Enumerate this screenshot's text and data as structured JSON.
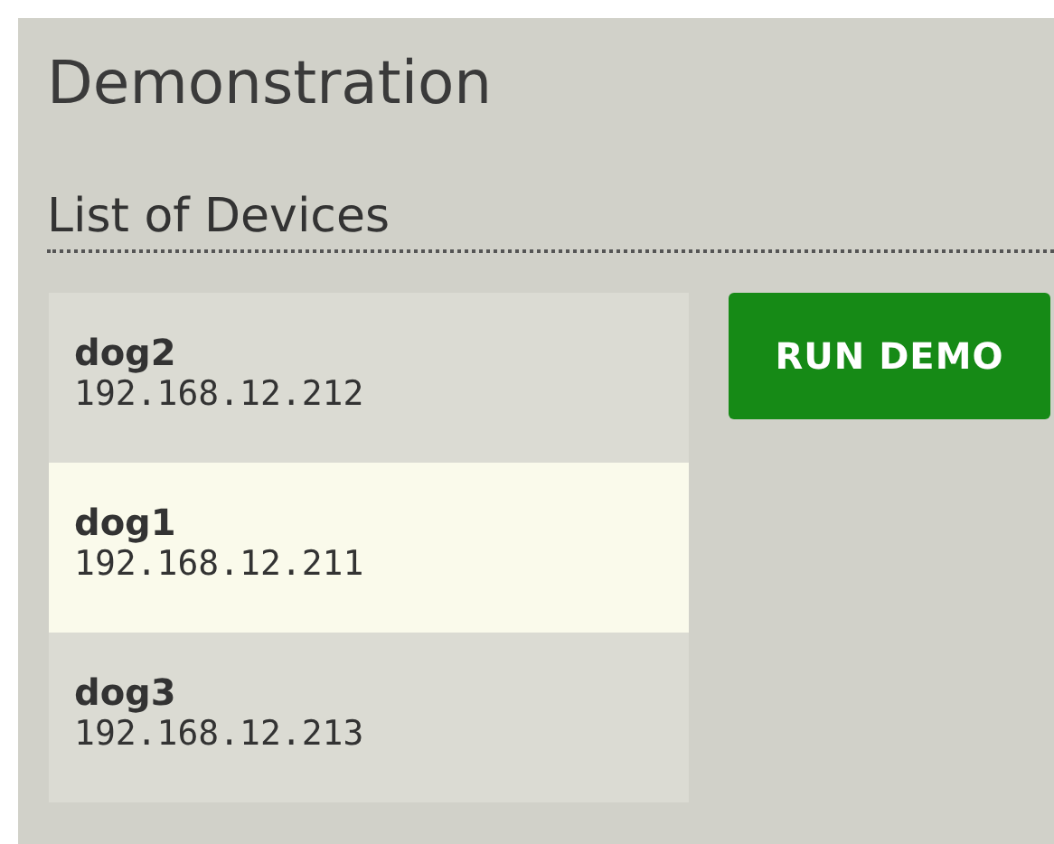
{
  "title": "Demonstration",
  "section": {
    "title": "List of Devices"
  },
  "devices": [
    {
      "name": "dog2",
      "address": "192.168.12.212",
      "selected": false
    },
    {
      "name": "dog1",
      "address": "192.168.12.211",
      "selected": true
    },
    {
      "name": "dog3",
      "address": "192.168.12.213",
      "selected": false
    }
  ],
  "button": {
    "label": "RUN DEMO"
  }
}
